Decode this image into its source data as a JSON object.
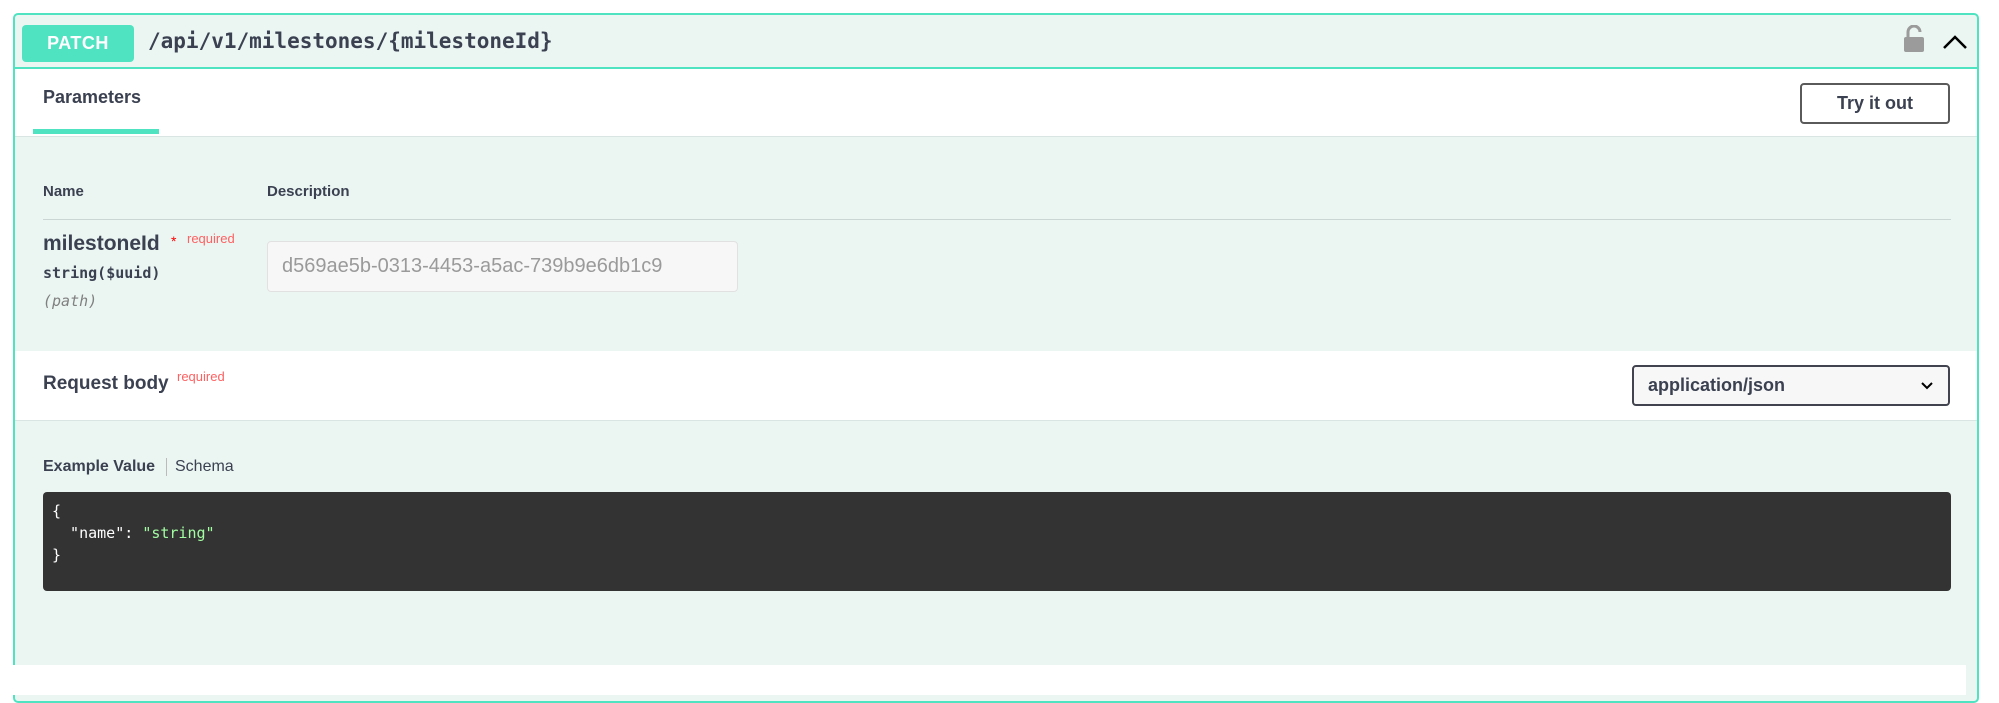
{
  "summary": {
    "method": "PATCH",
    "path": "/api/v1/milestones/{milestoneId}",
    "lock_icon": "unlocked-padlock-icon",
    "collapse_icon": "chevron-up-icon"
  },
  "tabs": {
    "parameters_label": "Parameters",
    "try_it_out_label": "Try it out"
  },
  "parameters": {
    "col_name": "Name",
    "col_description": "Description",
    "items": [
      {
        "name": "milestoneId",
        "required_star": "*",
        "required_label": "required",
        "type": "string($uuid)",
        "in": "(path)",
        "placeholder": "d569ae5b-0313-4453-a5ac-739b9e6db1c9"
      }
    ]
  },
  "request_body": {
    "title": "Request body",
    "required_label": "required",
    "content_type": "application/json",
    "content_type_options": [
      "application/json"
    ]
  },
  "examples": {
    "example_value_tab": "Example Value",
    "schema_tab": "Schema",
    "code_open": "{",
    "code_key": "  \"name\": ",
    "code_value": "\"string\"",
    "code_close": "}"
  },
  "colors": {
    "accent": "#50e3c2",
    "background": "#ebf6f3",
    "required": "#ff6060",
    "code_bg": "#333333",
    "code_string": "#a2fca2"
  }
}
